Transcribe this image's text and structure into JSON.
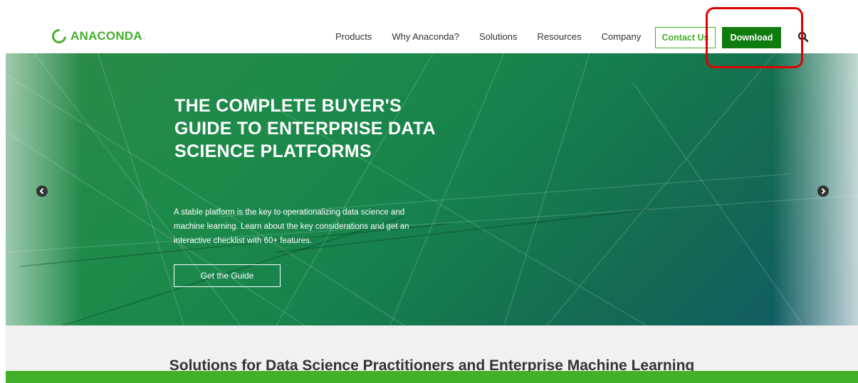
{
  "header": {
    "logo_text": "ANACONDA",
    "logo_dot": ".",
    "nav": [
      {
        "label": "Products"
      },
      {
        "label": "Why Anaconda?"
      },
      {
        "label": "Solutions"
      },
      {
        "label": "Resources"
      },
      {
        "label": "Company"
      }
    ],
    "contact_label": "Contact Us",
    "download_label": "Download",
    "search_icon": "search-icon"
  },
  "hero": {
    "title": "THE COMPLETE BUYER'S GUIDE TO ENTERPRISE DATA SCIENCE PLATFORMS",
    "description": "A stable platform is the key to operationalizing data science and machine learning. Learn about the key considerations and get an interactive checklist with 60+ features.",
    "cta_label": "Get the Guide",
    "prev_icon": "chevron-left-icon",
    "next_icon": "chevron-right-icon"
  },
  "solutions": {
    "title": "Solutions for Data Science Practitioners and Enterprise Machine Learning"
  },
  "colors": {
    "brand_green": "#43b02a",
    "download_green": "#107c10",
    "highlight_red": "#e00000"
  }
}
